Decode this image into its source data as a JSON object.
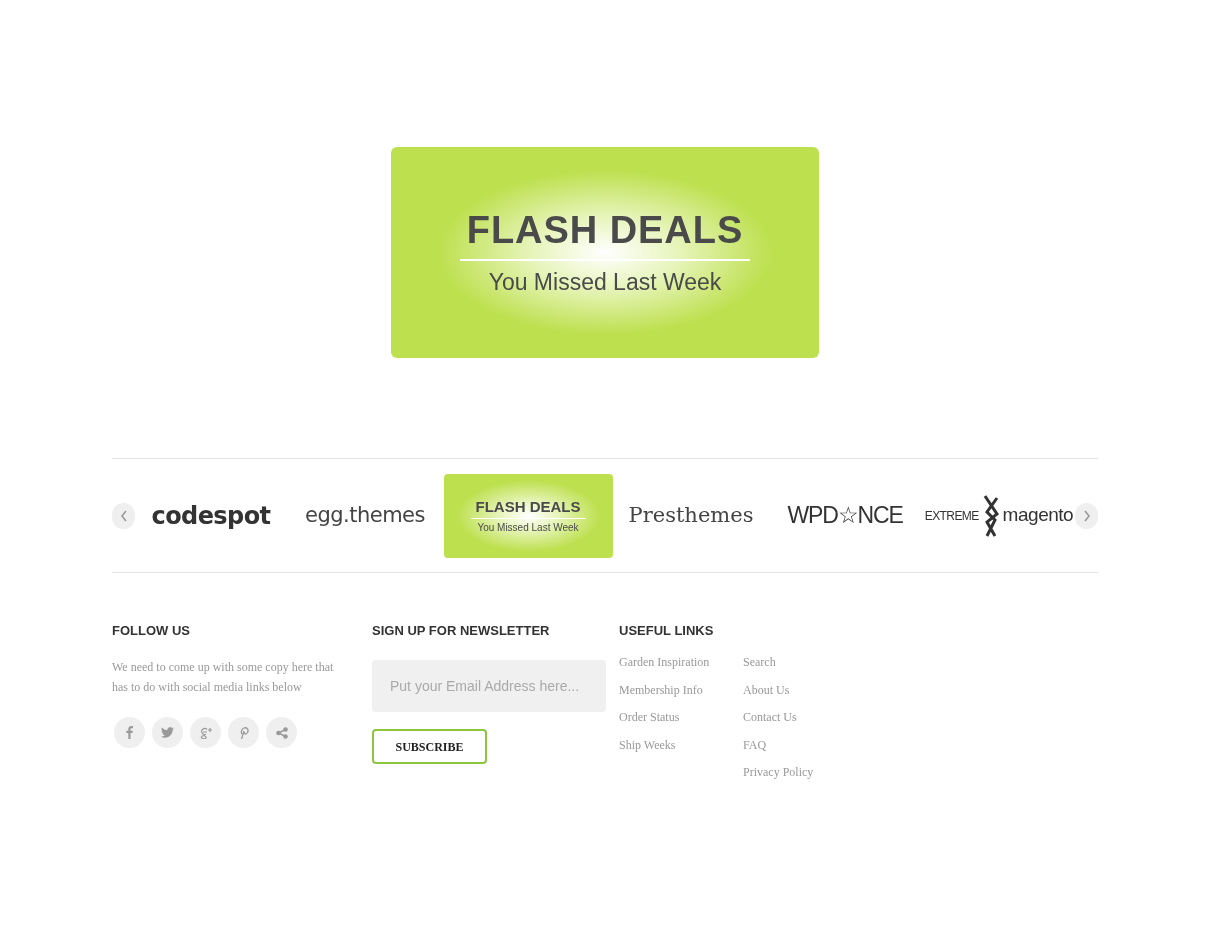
{
  "banner": {
    "title": "FLASH DEALS",
    "subtitle": "You Missed Last Week"
  },
  "carousel": {
    "logos": [
      {
        "kind": "bold",
        "text": "codespot"
      },
      {
        "kind": "light",
        "text": "egg.themes"
      },
      {
        "kind": "banner",
        "title": "FLASH DEALS",
        "subtitle": "You Missed Last Week"
      },
      {
        "kind": "serif",
        "text": "Presthemes"
      },
      {
        "kind": "thin",
        "text": "WPD☆NCE"
      },
      {
        "kind": "mark",
        "left": "EXTREME",
        "right": "magento"
      }
    ]
  },
  "follow_us": {
    "title": "FOLLOW US",
    "text": "We need to come up with some copy here that has to do with social media links below"
  },
  "newsletter": {
    "title": "SIGN UP FOR NEWSLETTER",
    "placeholder": "Put your Email Address here...",
    "button": "SUBSCRIBE"
  },
  "useful_links": {
    "title": "USEFUL LINKS",
    "columns": [
      [
        "Garden Inspiration",
        "Membership Info",
        "Order Status",
        "Ship Weeks"
      ],
      [
        "Search",
        "About Us",
        "Contact Us",
        "FAQ",
        "Privacy Policy"
      ]
    ]
  }
}
